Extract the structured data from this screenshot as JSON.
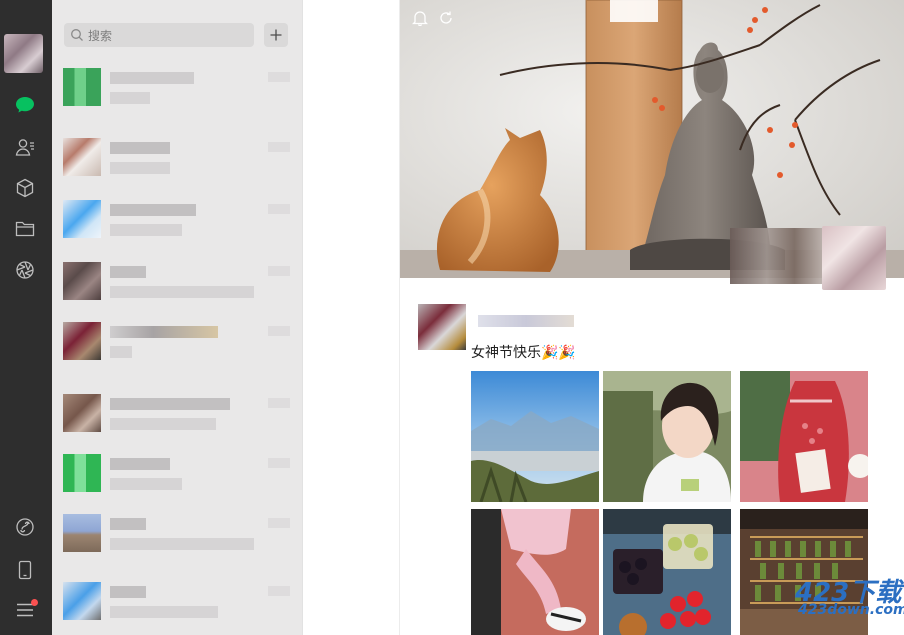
{
  "sidebar": {
    "icons": [
      "chat-icon",
      "contacts-icon",
      "favorites-cube-icon",
      "files-folder-icon",
      "moments-aperture-icon",
      "mini-program-icon",
      "phone-icon",
      "menu-icon"
    ],
    "accent": "#07c160",
    "dark_bg": "#2e2e2e",
    "menu_badge_color": "#fa5151"
  },
  "chat_list": {
    "search_placeholder": "搜索",
    "add_icon": "plus-icon",
    "items": [
      {
        "name": "",
        "preview": ""
      },
      {
        "name": "",
        "preview": ""
      },
      {
        "name": "",
        "preview": ""
      },
      {
        "name": "",
        "preview": ""
      },
      {
        "name": "",
        "preview": ""
      },
      {
        "name": "",
        "preview": ""
      },
      {
        "name": "",
        "preview": ""
      },
      {
        "name": "",
        "preview": ""
      },
      {
        "name": "",
        "preview": ""
      }
    ]
  },
  "moments": {
    "top_icons": [
      "bell-icon",
      "refresh-icon"
    ],
    "post": {
      "text": "女神节快乐🎉🎉",
      "photo_count": 6
    }
  },
  "watermark": {
    "main": "423下载",
    "url": "423down.com"
  }
}
